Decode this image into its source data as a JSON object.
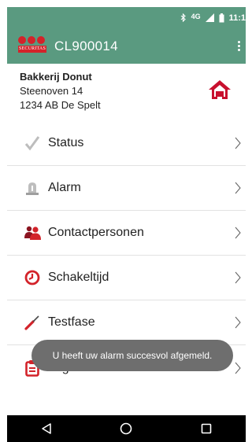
{
  "status_bar": {
    "bluetooth_icon": "bluetooth-icon",
    "network_label": "4G",
    "signal_icon": "signal-icon",
    "battery_icon": "battery-icon",
    "time": "11:1"
  },
  "app_bar": {
    "logo_text": "SECURITAS",
    "title": "CL900014",
    "overflow_icon": "more-vert-icon"
  },
  "customer": {
    "name": "Bakkerij Donut",
    "street": "Steenoven 14",
    "city": "1234 AB De Spelt",
    "home_icon": "home-icon"
  },
  "menu": [
    {
      "label": "Status",
      "icon": "check-icon"
    },
    {
      "label": "Alarm",
      "icon": "alarm-siren-icon"
    },
    {
      "label": "Contactpersonen",
      "icon": "contacts-icon"
    },
    {
      "label": "Schakeltijd",
      "icon": "clock-icon"
    },
    {
      "label": "Testfase",
      "icon": "screwdriver-icon"
    },
    {
      "label": "Logboek",
      "icon": "clipboard-icon"
    }
  ],
  "toast": {
    "message": "U heeft uw alarm succesvol afgemeld."
  },
  "nav_bar": {
    "back_icon": "back-icon",
    "home_icon": "nav-home-icon",
    "recents_icon": "recents-icon"
  },
  "colors": {
    "primary": "#5a9a80",
    "accent": "#d3232a",
    "toast": "#6e6e6e"
  }
}
